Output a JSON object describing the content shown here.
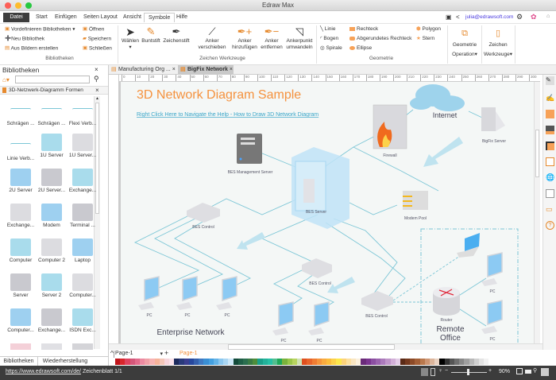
{
  "app": {
    "title": "Edraw Max"
  },
  "menu": {
    "items": [
      "Datei",
      "Start",
      "Einfügen",
      "Seiten Layout",
      "Ansicht",
      "Symbole",
      "Hilfe"
    ],
    "active": "Symbole",
    "user_email": "julia@edrawsoft.com"
  },
  "ribbon": {
    "bibliotheken": {
      "predefined": "Vordefinieren Bibliotheken",
      "new": "Neu Bibliothek",
      "from_images": "Aus Bildern erstellen",
      "open": "Öffnen",
      "save": "Speichern",
      "close": "Schließen",
      "group": "Bibliotheken"
    },
    "tools": {
      "select": "Wählen",
      "pencil": "Buntstift",
      "pen": "Zeichenstift",
      "move_anchor": [
        "Anker",
        "verschieben"
      ],
      "add_anchor": [
        "Anker",
        "hinzufügen"
      ],
      "remove_anchor": [
        "Anker",
        "entfernen"
      ],
      "convert_anchor": [
        "Ankerpunkt",
        "umwandeln"
      ],
      "group": "Zeichen Werkzeuge"
    },
    "geometry": {
      "line": "Linie",
      "arc": "Bogen",
      "spiral": "Spirale",
      "rect": "Rechteck",
      "rounded_rect": "Abgerundetes Rechteck",
      "ellipse": "Ellipse",
      "polygon": "Polygon",
      "star": "Stern",
      "group": "Geometrie"
    },
    "geo_op": [
      "Geometrie",
      "Operation"
    ],
    "draw_tools": [
      "Zeichen",
      "Werkzeuge"
    ]
  },
  "library": {
    "title": "Bibliotheken",
    "search_placeholder": "",
    "section": "3D-Netzwerk-Diagramm Formen",
    "shapes": [
      "Schrägen ...",
      "Schrägen ...",
      "Flexi Verb...",
      "Linie Verb...",
      "1U Server",
      "1U Server...",
      "2U Server",
      "2U Server...",
      "Exchange...",
      "Exchange...",
      "Modem",
      "Terminal ...",
      "Computer",
      "Computer 2",
      "Laptop",
      "Server",
      "Server 2",
      "Computer...",
      "Computer...",
      "Exchange...",
      "ISDN Exc..."
    ],
    "bottom_tabs": [
      "Bibliotheken",
      "Wiederherstellung"
    ]
  },
  "doc_tabs": [
    "Manufacturing Org ...",
    "BigFix Network"
  ],
  "active_doc_tab": "BigFix Network",
  "ruler": [
    "0",
    "10",
    "20",
    "30",
    "40",
    "50",
    "60",
    "70",
    "80",
    "90",
    "100",
    "110",
    "120",
    "130",
    "140",
    "150",
    "160",
    "170",
    "180",
    "190",
    "200",
    "210",
    "220",
    "230",
    "240",
    "250",
    "260",
    "270",
    "280",
    "290",
    "300"
  ],
  "diagram": {
    "title": "3D Network Diagram Sample",
    "link": "Right Click Here to Navigate the Help - How to Draw 3D Network Diagram",
    "labels": {
      "internet": "Internet",
      "firewall": "Firewall",
      "bigfix": "BigFix Server",
      "bes_mgmt": "BES Management Server",
      "bes_server": "BES Server",
      "modem_pool": "Modem Pool",
      "bes_control": "BES Control",
      "router": "Router",
      "pc": "PC",
      "enterprise": "Enterprise Network",
      "remote1": "Remote",
      "remote2": "Office"
    },
    "colors": {
      "title": "#f5923e",
      "link": "#3aa6c9",
      "line": "#7cc6d6"
    }
  },
  "pages": {
    "current": "Page-1",
    "tab": "Page-1"
  },
  "palette": [
    "#c0151b",
    "#d9262c",
    "#e0435f",
    "#d4577a",
    "#e26b8c",
    "#ec8aa1",
    "#f0a0a8",
    "#f7b3b3",
    "#f6b39a",
    "#f4c6b8",
    "#f7d4dc",
    "#f9e1ea",
    "#1c2a5c",
    "#2a3a7a",
    "#3b3f8f",
    "#27479c",
    "#3560ad",
    "#3f79c2",
    "#3a8fd4",
    "#44a0e0",
    "#63b3e8",
    "#8bc7ef",
    "#a9d6f3",
    "#cde7f8",
    "#134a3a",
    "#1f5e47",
    "#2b6e4f",
    "#3a7a44",
    "#4e8d3b",
    "#1aa08a",
    "#23b29a",
    "#27c0a5",
    "#52bf8f",
    "#1fa85a",
    "#7ab33c",
    "#9ac64a",
    "#b7d45f",
    "#cfe2b4",
    "#e0501f",
    "#e8652b",
    "#f07d33",
    "#f5953d",
    "#f9ab3f",
    "#fbbd3d",
    "#fdd14a",
    "#fde74c",
    "#fdd37a",
    "#fce0a0",
    "#f9e6c2",
    "#fbf0dd",
    "#6a2b7a",
    "#7b3690",
    "#8b4fa1",
    "#9b64ae",
    "#ab7abb",
    "#bf95c9",
    "#d2b0d8",
    "#e3cde7",
    "#5a2a16",
    "#74391e",
    "#8c4a27",
    "#a35f36",
    "#b9784d",
    "#cd9572",
    "#dcb59b",
    "#e9d2c2",
    "#000000",
    "#333333",
    "#555555",
    "#6f6f6f",
    "#888888",
    "#a0a0a0",
    "#b8b8b8",
    "#d0d0d0",
    "#e4e4e4",
    "#f2f2f2"
  ],
  "status": {
    "url": "https://www.edrawsoft.com/de/",
    "sheet": "Zeichenblatt 1/1",
    "zoom": "90%",
    "zoom_level": 0.45
  }
}
